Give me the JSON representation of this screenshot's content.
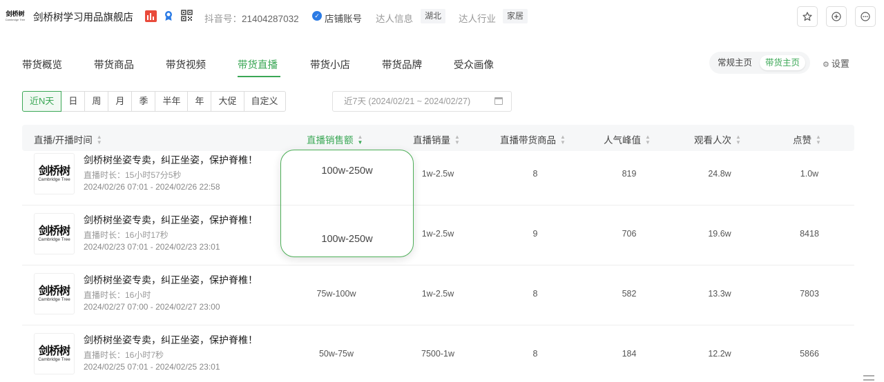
{
  "header": {
    "logo_text": "剑桥树",
    "logo_sub": "Cambridge Tree",
    "shop_name": "剑桥树学习用品旗舰店",
    "douyin_label": "抖音号：",
    "douyin_id": "21404287032",
    "verified_text": "店铺账号",
    "info_label": "达人信息",
    "region_tag": "湖北",
    "industry_label": "达人行业",
    "industry_tag": "家居",
    "buttons": [
      "star-icon",
      "plus-circle-icon",
      "more-icon"
    ]
  },
  "tabs": [
    "带货概览",
    "带货商品",
    "带货视频",
    "带货直播",
    "带货小店",
    "带货品牌",
    "受众画像"
  ],
  "active_tab": "带货直播",
  "switch": {
    "normal": "常规主页",
    "selling": "带货主页"
  },
  "settings_label": "设置",
  "filters": [
    "近N天",
    "日",
    "周",
    "月",
    "季",
    "半年",
    "年",
    "大促",
    "自定义"
  ],
  "active_filter": "近N天",
  "date_range": "近7天 (2024/02/21 ~ 2024/02/27)",
  "columns": [
    "直播/开播时间",
    "直播销售额",
    "直播销量",
    "直播带货商品",
    "人气峰值",
    "观看人次",
    "点赞"
  ],
  "sorted_column": "直播销售额",
  "rows": [
    {
      "title": "剑桥树坐姿专卖，纠正坐姿，保护脊椎！",
      "duration": "直播时长：15小时57分5秒",
      "time": "2024/02/26 07:01 - 2024/02/26 22:58",
      "sales": "100w-250w",
      "volume": "1w-2.5w",
      "products": "8",
      "peak": "819",
      "views": "24.8w",
      "likes": "1.0w"
    },
    {
      "title": "剑桥树坐姿专卖，纠正坐姿，保护脊椎！",
      "duration": "直播时长：16小时17秒",
      "time": "2024/02/23 07:01 - 2024/02/23 23:01",
      "sales": "100w-250w",
      "volume": "1w-2.5w",
      "products": "9",
      "peak": "706",
      "views": "19.6w",
      "likes": "8418"
    },
    {
      "title": "剑桥树坐姿专卖，纠正坐姿，保护脊椎！",
      "duration": "直播时长：16小时",
      "time": "2024/02/27 07:00 - 2024/02/27 23:00",
      "sales": "75w-100w",
      "volume": "1w-2.5w",
      "products": "8",
      "peak": "582",
      "views": "13.3w",
      "likes": "7803"
    },
    {
      "title": "剑桥树坐姿专卖，纠正坐姿，保护脊椎！",
      "duration": "直播时长：16小时7秒",
      "time": "2024/02/25 07:01 - 2024/02/25 23:01",
      "sales": "50w-75w",
      "volume": "7500-1w",
      "products": "8",
      "peak": "184",
      "views": "12.2w",
      "likes": "5866"
    }
  ],
  "colors": {
    "accent": "#3aa755",
    "brand_red": "#e94a3b",
    "verified_blue": "#2b7be5"
  }
}
